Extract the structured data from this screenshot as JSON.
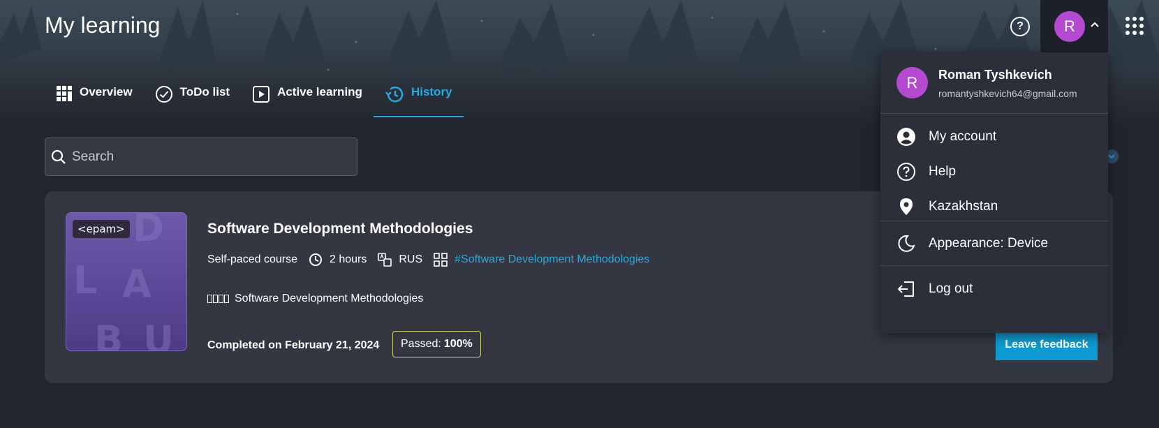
{
  "header": {
    "title": "My learning",
    "help_icon": "question-circle-icon",
    "avatar_initial": "R",
    "apps_icon": "grid-dots-icon"
  },
  "tabs": [
    {
      "label": "Overview",
      "icon": "grid-icon",
      "active": false
    },
    {
      "label": "ToDo list",
      "icon": "check-circle-icon",
      "active": false
    },
    {
      "label": "Active learning",
      "icon": "play-icon",
      "active": false
    },
    {
      "label": "History",
      "icon": "history-icon",
      "active": true
    }
  ],
  "search": {
    "placeholder": "Search"
  },
  "course": {
    "title": "Software Development Methodologies",
    "logo_text": "<epam>",
    "type": "Self-paced course",
    "duration": "2 hours",
    "language": "RUS",
    "tag": "#Software Development Methodologies",
    "provider_name": "Software Development Methodologies",
    "completed": "Completed on February 21, 2024",
    "passed_label": "Passed:",
    "passed_value": "100%",
    "feedback_label": "Leave feedback"
  },
  "user_menu": {
    "avatar_initial": "R",
    "name": "Roman Tyshkevich",
    "email": "romantyshkevich64@gmail.com",
    "items": [
      {
        "label": "My account",
        "icon": "user-circle-icon"
      },
      {
        "label": "Help",
        "icon": "question-circle-icon"
      },
      {
        "label": "Kazakhstan",
        "icon": "location-pin-icon"
      },
      {
        "label": "Appearance: Device",
        "icon": "moon-icon"
      },
      {
        "label": "Log out",
        "icon": "logout-icon"
      }
    ]
  },
  "colors": {
    "accent": "#2aa9dd",
    "avatar": "#b44ad0",
    "button": "#0f9bd1",
    "passed_border": "#c8d160"
  }
}
